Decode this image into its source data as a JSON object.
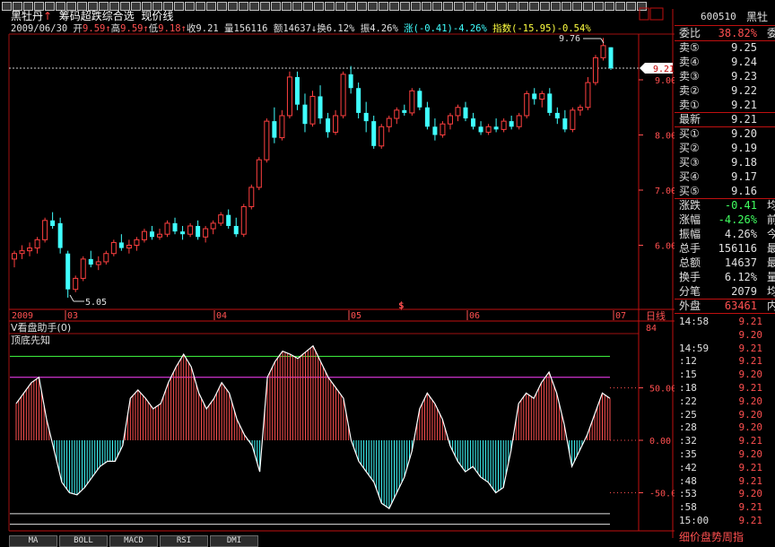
{
  "header": {
    "stock_name": "黑牡丹",
    "indicator_title": "筹码超跌综合选",
    "line_mode": "现价线",
    "info": {
      "date": "2009/06/30",
      "open_label": "开",
      "open": "9.59",
      "high_label": "高",
      "high": "9.59",
      "low_label": "低",
      "low": "9.18",
      "close_label": "收",
      "close": "9.21",
      "vol_label": "量",
      "vol": "156116",
      "amt_label": "额",
      "amt": "14637",
      "turn_label": "换",
      "turn": "6.12%",
      "amp_label": "振",
      "amp": "4.26%",
      "chg_label": "涨",
      "chg": "(-0.41)-4.26%",
      "idx_label": "指数",
      "idx": "(-15.95)-0.54%"
    }
  },
  "price_chart": {
    "hi_label": "9.76",
    "lo_label": "5.05",
    "current_tag": "9.21",
    "y_labels": [
      "9.00",
      "8.00",
      "7.00",
      "6.00"
    ],
    "months": [
      "2009",
      "03",
      "04",
      "05",
      "06",
      "07"
    ],
    "day_label": "日线",
    "marker": "$"
  },
  "indicator": {
    "title": "V看盘助手(0)",
    "subtitle": "顶底先知",
    "y_labels": [
      "50.00",
      "0.00",
      "-50.00"
    ],
    "top_label": "84"
  },
  "tabs": [
    "MA",
    "BOLL",
    "MACD",
    "RSI",
    "DMI"
  ],
  "quote_panel": {
    "code": "600510",
    "name": "黑牡",
    "wb_label": "委比",
    "wb_value": "38.82%",
    "wc_label": "委",
    "sells": [
      {
        "label": "卖⑤",
        "price": "9.25"
      },
      {
        "label": "卖④",
        "price": "9.24"
      },
      {
        "label": "卖③",
        "price": "9.23"
      },
      {
        "label": "卖②",
        "price": "9.22"
      },
      {
        "label": "卖①",
        "price": "9.21"
      }
    ],
    "last_label": "最新",
    "last": "9.21",
    "buys": [
      {
        "label": "买①",
        "price": "9.20"
      },
      {
        "label": "买②",
        "price": "9.19"
      },
      {
        "label": "买③",
        "price": "9.18"
      },
      {
        "label": "买④",
        "price": "9.17"
      },
      {
        "label": "买⑤",
        "price": "9.16"
      }
    ],
    "stats": [
      {
        "label": "涨跌",
        "value": "-0.41",
        "extra": "均",
        "color": "#40ff60"
      },
      {
        "label": "涨幅",
        "value": "-4.26%",
        "extra": "前",
        "color": "#40ff60"
      },
      {
        "label": "振幅",
        "value": "4.26%",
        "extra": "今",
        "color": "#e0e0e0"
      },
      {
        "label": "总手",
        "value": "156116",
        "extra": "最",
        "color": "#e0e0e0"
      },
      {
        "label": "总额",
        "value": "14637",
        "extra": "最",
        "color": "#e0e0e0"
      },
      {
        "label": "换手",
        "value": "6.12%",
        "extra": "量",
        "color": "#e0e0e0"
      },
      {
        "label": "分笔",
        "value": "2079",
        "extra": "均",
        "color": "#e0e0e0"
      }
    ],
    "outer_label": "外盘",
    "outer_value": "63461",
    "inner_label": "内",
    "ticks": [
      {
        "time": "14:58",
        "price": "9.21"
      },
      {
        "time": "",
        "price": "9.20"
      },
      {
        "time": "14:59",
        "price": "9.21"
      },
      {
        "time": ":12",
        "price": "9.21"
      },
      {
        "time": ":15",
        "price": "9.20"
      },
      {
        "time": ":18",
        "price": "9.21"
      },
      {
        "time": ":22",
        "price": "9.20"
      },
      {
        "time": ":25",
        "price": "9.20"
      },
      {
        "time": ":28",
        "price": "9.20"
      },
      {
        "time": ":32",
        "price": "9.21"
      },
      {
        "time": ":35",
        "price": "9.20"
      },
      {
        "time": ":42",
        "price": "9.21"
      },
      {
        "time": ":48",
        "price": "9.21"
      },
      {
        "time": ":53",
        "price": "9.20"
      },
      {
        "time": ":58",
        "price": "9.21"
      },
      {
        "time": "15:00",
        "price": "9.21"
      }
    ],
    "footer": "细价盘势周指"
  },
  "chart_data": [
    {
      "type": "candlestick",
      "title": "黑牡丹 筹码超跌综合选 现价线",
      "x_label_months": [
        "2009",
        "03",
        "04",
        "05",
        "06",
        "07"
      ],
      "ylim": [
        5.0,
        9.8
      ],
      "annotations": {
        "high": 9.76,
        "low": 5.05,
        "current": 9.21
      },
      "candles": [
        {
          "o": 5.75,
          "h": 5.9,
          "l": 5.6,
          "c": 5.85
        },
        {
          "o": 5.85,
          "h": 6.0,
          "l": 5.75,
          "c": 5.9
        },
        {
          "o": 5.9,
          "h": 6.05,
          "l": 5.8,
          "c": 5.95
        },
        {
          "o": 5.95,
          "h": 6.15,
          "l": 5.85,
          "c": 6.1
        },
        {
          "o": 6.1,
          "h": 6.5,
          "l": 6.05,
          "c": 6.45
        },
        {
          "o": 6.45,
          "h": 6.6,
          "l": 6.3,
          "c": 6.35
        },
        {
          "o": 6.4,
          "h": 6.5,
          "l": 5.85,
          "c": 5.95
        },
        {
          "o": 5.85,
          "h": 5.9,
          "l": 5.05,
          "c": 5.2
        },
        {
          "o": 5.2,
          "h": 5.45,
          "l": 5.15,
          "c": 5.4
        },
        {
          "o": 5.4,
          "h": 5.8,
          "l": 5.35,
          "c": 5.75
        },
        {
          "o": 5.75,
          "h": 5.9,
          "l": 5.6,
          "c": 5.65
        },
        {
          "o": 5.65,
          "h": 5.8,
          "l": 5.55,
          "c": 5.7
        },
        {
          "o": 5.7,
          "h": 5.9,
          "l": 5.65,
          "c": 5.85
        },
        {
          "o": 5.85,
          "h": 6.1,
          "l": 5.8,
          "c": 6.05
        },
        {
          "o": 6.05,
          "h": 6.2,
          "l": 5.9,
          "c": 5.95
        },
        {
          "o": 5.95,
          "h": 6.1,
          "l": 5.85,
          "c": 6.0
        },
        {
          "o": 6.0,
          "h": 6.15,
          "l": 5.9,
          "c": 6.1
        },
        {
          "o": 6.1,
          "h": 6.3,
          "l": 6.05,
          "c": 6.25
        },
        {
          "o": 6.25,
          "h": 6.35,
          "l": 6.1,
          "c": 6.15
        },
        {
          "o": 6.15,
          "h": 6.3,
          "l": 6.1,
          "c": 6.2
        },
        {
          "o": 6.2,
          "h": 6.45,
          "l": 6.15,
          "c": 6.4
        },
        {
          "o": 6.4,
          "h": 6.5,
          "l": 6.2,
          "c": 6.25
        },
        {
          "o": 6.25,
          "h": 6.35,
          "l": 6.1,
          "c": 6.2
        },
        {
          "o": 6.2,
          "h": 6.4,
          "l": 6.15,
          "c": 6.35
        },
        {
          "o": 6.35,
          "h": 6.45,
          "l": 6.1,
          "c": 6.15
        },
        {
          "o": 6.15,
          "h": 6.35,
          "l": 6.05,
          "c": 6.3
        },
        {
          "o": 6.3,
          "h": 6.45,
          "l": 6.2,
          "c": 6.4
        },
        {
          "o": 6.4,
          "h": 6.6,
          "l": 6.35,
          "c": 6.55
        },
        {
          "o": 6.55,
          "h": 6.65,
          "l": 6.3,
          "c": 6.35
        },
        {
          "o": 6.35,
          "h": 6.5,
          "l": 6.15,
          "c": 6.2
        },
        {
          "o": 6.2,
          "h": 6.75,
          "l": 6.15,
          "c": 6.7
        },
        {
          "o": 6.7,
          "h": 7.1,
          "l": 6.65,
          "c": 7.05
        },
        {
          "o": 7.05,
          "h": 7.6,
          "l": 7.0,
          "c": 7.55
        },
        {
          "o": 7.55,
          "h": 8.3,
          "l": 7.5,
          "c": 8.25
        },
        {
          "o": 8.25,
          "h": 8.5,
          "l": 7.85,
          "c": 7.95
        },
        {
          "o": 7.95,
          "h": 8.45,
          "l": 7.9,
          "c": 8.35
        },
        {
          "o": 8.35,
          "h": 9.15,
          "l": 8.3,
          "c": 9.05
        },
        {
          "o": 9.05,
          "h": 9.15,
          "l": 8.45,
          "c": 8.55
        },
        {
          "o": 8.55,
          "h": 8.75,
          "l": 8.05,
          "c": 8.2
        },
        {
          "o": 8.2,
          "h": 8.8,
          "l": 8.15,
          "c": 8.7
        },
        {
          "o": 8.7,
          "h": 8.9,
          "l": 8.2,
          "c": 8.3
        },
        {
          "o": 8.3,
          "h": 8.4,
          "l": 7.95,
          "c": 8.05
        },
        {
          "o": 8.05,
          "h": 8.45,
          "l": 8.0,
          "c": 8.35
        },
        {
          "o": 8.35,
          "h": 9.15,
          "l": 8.3,
          "c": 9.1
        },
        {
          "o": 9.1,
          "h": 9.25,
          "l": 8.75,
          "c": 8.85
        },
        {
          "o": 8.85,
          "h": 8.95,
          "l": 8.3,
          "c": 8.4
        },
        {
          "o": 8.4,
          "h": 8.6,
          "l": 8.05,
          "c": 8.25
        },
        {
          "o": 8.25,
          "h": 8.35,
          "l": 7.75,
          "c": 7.8
        },
        {
          "o": 7.8,
          "h": 8.2,
          "l": 7.75,
          "c": 8.15
        },
        {
          "o": 8.15,
          "h": 8.35,
          "l": 8.05,
          "c": 8.3
        },
        {
          "o": 8.3,
          "h": 8.5,
          "l": 8.2,
          "c": 8.45
        },
        {
          "o": 8.45,
          "h": 8.55,
          "l": 8.35,
          "c": 8.4
        },
        {
          "o": 8.4,
          "h": 8.85,
          "l": 8.35,
          "c": 8.8
        },
        {
          "o": 8.8,
          "h": 8.85,
          "l": 8.45,
          "c": 8.5
        },
        {
          "o": 8.5,
          "h": 8.6,
          "l": 8.1,
          "c": 8.15
        },
        {
          "o": 8.15,
          "h": 8.3,
          "l": 7.9,
          "c": 8.0
        },
        {
          "o": 8.0,
          "h": 8.25,
          "l": 7.95,
          "c": 8.2
        },
        {
          "o": 8.2,
          "h": 8.4,
          "l": 8.1,
          "c": 8.35
        },
        {
          "o": 8.35,
          "h": 8.55,
          "l": 8.25,
          "c": 8.5
        },
        {
          "o": 8.5,
          "h": 8.6,
          "l": 8.25,
          "c": 8.3
        },
        {
          "o": 8.3,
          "h": 8.4,
          "l": 8.1,
          "c": 8.15
        },
        {
          "o": 8.15,
          "h": 8.25,
          "l": 8.0,
          "c": 8.05
        },
        {
          "o": 8.05,
          "h": 8.2,
          "l": 8.0,
          "c": 8.15
        },
        {
          "o": 8.15,
          "h": 8.3,
          "l": 8.05,
          "c": 8.1
        },
        {
          "o": 8.1,
          "h": 8.3,
          "l": 8.05,
          "c": 8.25
        },
        {
          "o": 8.25,
          "h": 8.35,
          "l": 8.1,
          "c": 8.15
        },
        {
          "o": 8.15,
          "h": 8.4,
          "l": 8.1,
          "c": 8.35
        },
        {
          "o": 8.35,
          "h": 8.8,
          "l": 8.3,
          "c": 8.75
        },
        {
          "o": 8.75,
          "h": 8.85,
          "l": 8.55,
          "c": 8.65
        },
        {
          "o": 8.65,
          "h": 8.8,
          "l": 8.5,
          "c": 8.75
        },
        {
          "o": 8.75,
          "h": 8.85,
          "l": 8.35,
          "c": 8.4
        },
        {
          "o": 8.4,
          "h": 8.5,
          "l": 8.2,
          "c": 8.3
        },
        {
          "o": 8.3,
          "h": 8.45,
          "l": 8.05,
          "c": 8.1
        },
        {
          "o": 8.1,
          "h": 8.5,
          "l": 8.05,
          "c": 8.45
        },
        {
          "o": 8.45,
          "h": 8.55,
          "l": 8.35,
          "c": 8.5
        },
        {
          "o": 8.5,
          "h": 9.05,
          "l": 8.45,
          "c": 8.95
        },
        {
          "o": 8.95,
          "h": 9.45,
          "l": 8.9,
          "c": 9.4
        },
        {
          "o": 9.4,
          "h": 9.76,
          "l": 9.35,
          "c": 9.62
        },
        {
          "o": 9.59,
          "h": 9.59,
          "l": 9.18,
          "c": 9.21
        }
      ]
    },
    {
      "type": "bar",
      "title": "V看盘助手(0) 顶底先知",
      "ylim": [
        -75,
        90
      ],
      "reference_lines": [
        80,
        60,
        -70,
        -80
      ],
      "values": [
        35,
        45,
        55,
        60,
        20,
        -10,
        -40,
        -50,
        -52,
        -45,
        -35,
        -25,
        -20,
        -20,
        -5,
        40,
        48,
        40,
        30,
        35,
        55,
        70,
        82,
        70,
        45,
        30,
        40,
        55,
        45,
        20,
        5,
        -5,
        -30,
        60,
        75,
        85,
        82,
        78,
        84,
        90,
        75,
        60,
        50,
        40,
        0,
        -20,
        -30,
        -40,
        -60,
        -65,
        -50,
        -35,
        -10,
        30,
        45,
        35,
        20,
        -5,
        -20,
        -30,
        -25,
        -35,
        -40,
        -50,
        -45,
        -10,
        35,
        45,
        40,
        55,
        65,
        45,
        15,
        -25,
        -10,
        5,
        25,
        45,
        40
      ]
    }
  ]
}
